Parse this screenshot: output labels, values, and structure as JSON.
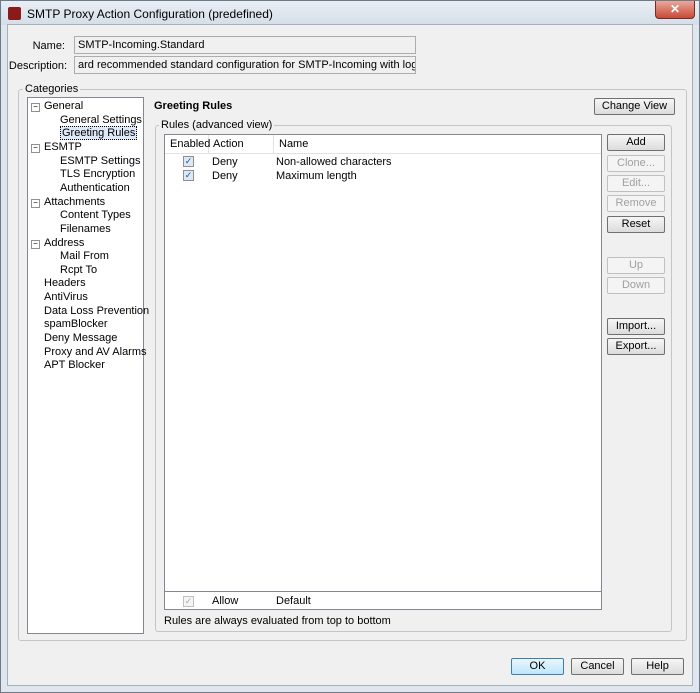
{
  "window": {
    "title": "SMTP Proxy Action Configuration (predefined)",
    "close": "✕"
  },
  "form": {
    "name_label": "Name:",
    "name_value": "SMTP-Incoming.Standard",
    "description_label": "Description:",
    "description_value": "ard recommended standard configuration for SMTP-Incoming with logging enabled"
  },
  "categories": {
    "label": "Categories",
    "items": [
      {
        "label": "General",
        "level": 0,
        "expander": "⊟"
      },
      {
        "label": "General Settings",
        "level": 1
      },
      {
        "label": "Greeting Rules",
        "level": 1,
        "selected": true
      },
      {
        "label": "ESMTP",
        "level": 0,
        "expander": "⊟"
      },
      {
        "label": "ESMTP Settings",
        "level": 1
      },
      {
        "label": "TLS Encryption",
        "level": 1
      },
      {
        "label": "Authentication",
        "level": 1
      },
      {
        "label": "Attachments",
        "level": 0,
        "expander": "⊟"
      },
      {
        "label": "Content Types",
        "level": 1
      },
      {
        "label": "Filenames",
        "level": 1
      },
      {
        "label": "Address",
        "level": 0,
        "expander": "⊟"
      },
      {
        "label": "Mail From",
        "level": 1
      },
      {
        "label": "Rcpt To",
        "level": 1
      },
      {
        "label": "Headers",
        "level": 0
      },
      {
        "label": "AntiVirus",
        "level": 0
      },
      {
        "label": "Data Loss Prevention",
        "level": 0
      },
      {
        "label": "spamBlocker",
        "level": 0
      },
      {
        "label": "Deny Message",
        "level": 0
      },
      {
        "label": "Proxy and AV Alarms",
        "level": 0
      },
      {
        "label": "APT Blocker",
        "level": 0
      }
    ]
  },
  "panel": {
    "title": "Greeting Rules",
    "change_view": "Change View",
    "rules_group": "Rules (advanced view)",
    "columns": [
      "Enabled",
      "Action",
      "Name"
    ],
    "rows": [
      {
        "enabled": true,
        "action": "Deny",
        "name": "Non-allowed characters"
      },
      {
        "enabled": true,
        "action": "Deny",
        "name": "Maximum length"
      }
    ],
    "default_row": {
      "enabled": true,
      "action": "Allow",
      "name": "Default"
    },
    "note": "Rules are always evaluated from top to bottom",
    "buttons": [
      {
        "label": "Add",
        "enabled": true
      },
      {
        "label": "Clone...",
        "enabled": false
      },
      {
        "label": "Edit...",
        "enabled": false
      },
      {
        "label": "Remove",
        "enabled": false
      },
      {
        "label": "Reset",
        "enabled": true
      },
      {
        "label": "Up",
        "enabled": false
      },
      {
        "label": "Down",
        "enabled": false
      },
      {
        "label": "Import...",
        "enabled": true
      },
      {
        "label": "Export...",
        "enabled": true
      }
    ]
  },
  "footer": {
    "ok": "OK",
    "cancel": "Cancel",
    "help": "Help"
  }
}
